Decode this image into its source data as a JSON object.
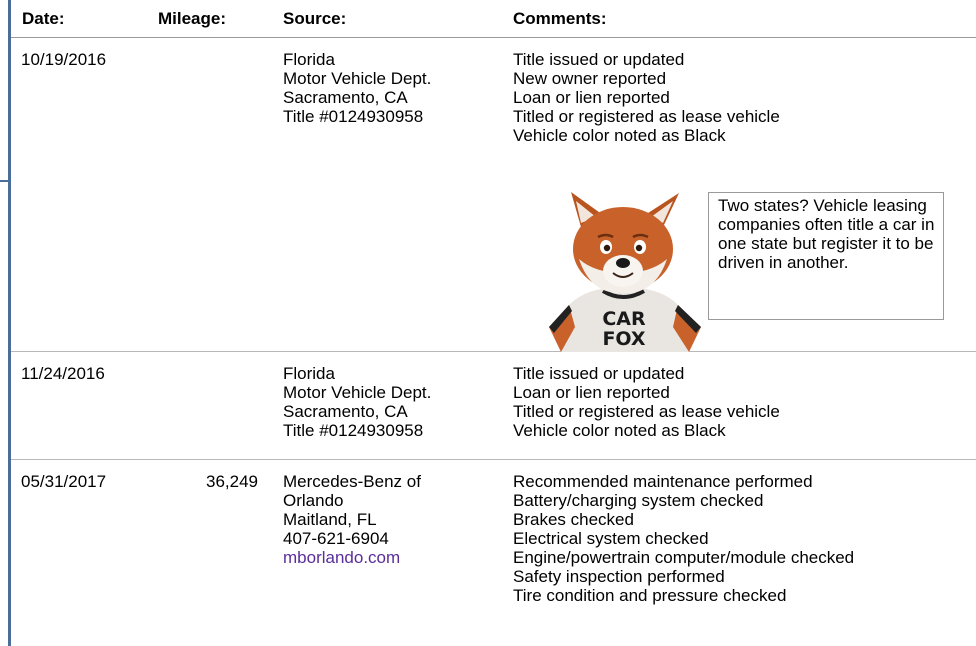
{
  "header": {
    "date": "Date:",
    "mileage": "Mileage:",
    "source": "Source:",
    "comments": "Comments:"
  },
  "records": [
    {
      "date": "10/19/2016",
      "mileage": "",
      "source": [
        "Florida",
        "Motor Vehicle Dept.",
        "Sacramento, CA",
        "Title #0124930958"
      ],
      "comments": [
        "Title issued or updated",
        "New owner reported",
        "Loan or lien reported",
        "Titled or registered as lease vehicle",
        "Vehicle color noted as Black"
      ],
      "callout": "Two states? Vehicle leasing companies often title a car in one state but register it to be driven in another."
    },
    {
      "date": "11/24/2016",
      "mileage": "",
      "source": [
        "Florida",
        "Motor Vehicle Dept.",
        "Sacramento, CA",
        "Title #0124930958"
      ],
      "comments": [
        "Title issued or updated",
        "Loan or lien reported",
        "Titled or registered as lease vehicle",
        "Vehicle color noted as Black"
      ]
    },
    {
      "date": "05/31/2017",
      "mileage": "36,249",
      "source": [
        "Mercedes-Benz of",
        "Orlando",
        "Maitland, FL",
        "407-621-6904"
      ],
      "source_link": "mborlando.com",
      "comments": [
        "Recommended maintenance performed",
        "Battery/charging system checked",
        "Brakes checked",
        "Electrical system checked",
        "Engine/powertrain computer/module checked",
        "Safety inspection performed",
        "Tire condition and pressure checked"
      ]
    }
  ],
  "mascot": {
    "shirt_line_1": "CAR",
    "shirt_line_2": "FOX"
  },
  "colors": {
    "rule": "#4a6d9a",
    "link": "#5a2d9a",
    "fox_orange": "#c8622a"
  }
}
